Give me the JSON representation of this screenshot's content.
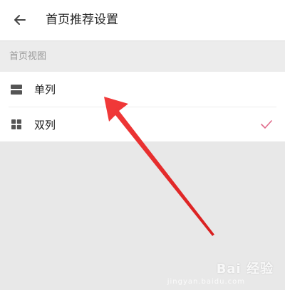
{
  "appbar": {
    "title": "首页推荐设置",
    "back_icon": "arrow-left-icon"
  },
  "section": {
    "title": "首页视图"
  },
  "options": [
    {
      "label": "单列",
      "icon": "single-column-icon",
      "selected": false
    },
    {
      "label": "双列",
      "icon": "grid-icon",
      "selected": true
    }
  ],
  "colors": {
    "checkmark": "#e06a8a",
    "annotation_arrow": "#ee2d2d",
    "icon": "#555555"
  },
  "watermark": {
    "brand": "Bai 经验",
    "url": "jingyan.baidu.com"
  }
}
